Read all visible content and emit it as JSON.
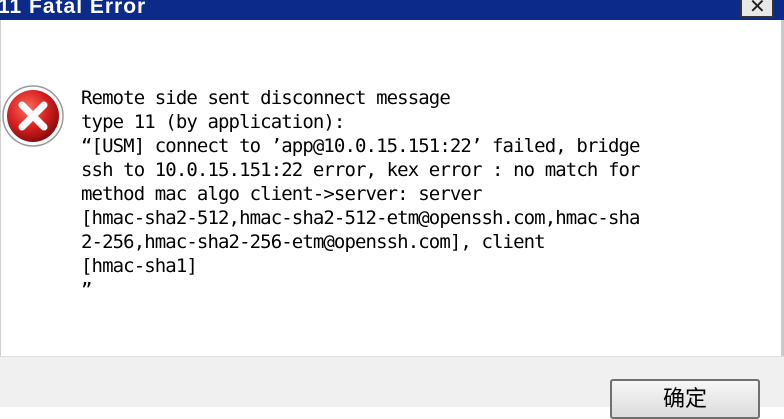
{
  "window": {
    "title": "11 Fatal Error",
    "close_glyph": "✕"
  },
  "dialog": {
    "icon": "error-icon",
    "message_lines": [
      "Remote side sent disconnect message",
      "type 11 (by application):",
      "“[USM] connect to ’app@10.0.15.151:22’ failed, bridge",
      "ssh to 10.0.15.151:22 error, kex error : no match for",
      "method mac algo client->server: server",
      "[hmac-sha2-512,hmac-sha2-512-etm@openssh.com,hmac-sha",
      "2-256,hmac-sha2-256-etm@openssh.com], client",
      "[hmac-sha1]",
      "”"
    ]
  },
  "buttons": {
    "ok_label": "确定"
  },
  "colors": {
    "titlebar": "#0c2a8a",
    "error_red": "#d42020",
    "footer_bg": "#f0f0f0"
  }
}
